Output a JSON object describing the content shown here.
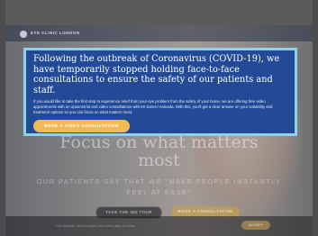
{
  "header": {
    "logo_text": "EYE CLINIC LONDON"
  },
  "hero": {
    "title_line1": "Focus on what matters",
    "title_line2": "most",
    "subtitle_line1": "OUR PATIENTS SAY THAT WE \"MAKE PEOPLE INSTANTLY",
    "subtitle_line2": "FEEL AT EASE\"",
    "tour_button": "TAKE THE 360 TOUR",
    "book_button": "BOOK A CONSULTATION"
  },
  "cookie_bar": {
    "text": "Our website uses cookies and third party services.",
    "accept_button": "ACCEPT"
  },
  "modal": {
    "heading": "Following the outbreak of Coronavirus (COVID-19), we have temporarily stopped holding face-to-face consultations to ensure the safety of our patients and staff.",
    "body": "If you would like to take the first step to experience relief from your eye problem from the safety of your home, we are offering free video appointments with an optometrist and video consultations with Mr Samer Hamada. With this, you'll get a clear answer on your suitability and treatment options so you can focus on what matters most.",
    "cta": "BOOK A VIDEO CONSULTATION"
  },
  "colors": {
    "modal_bg": "#224a96",
    "modal_border": "#8fd1e6",
    "cta_bg": "#f2ba56"
  }
}
